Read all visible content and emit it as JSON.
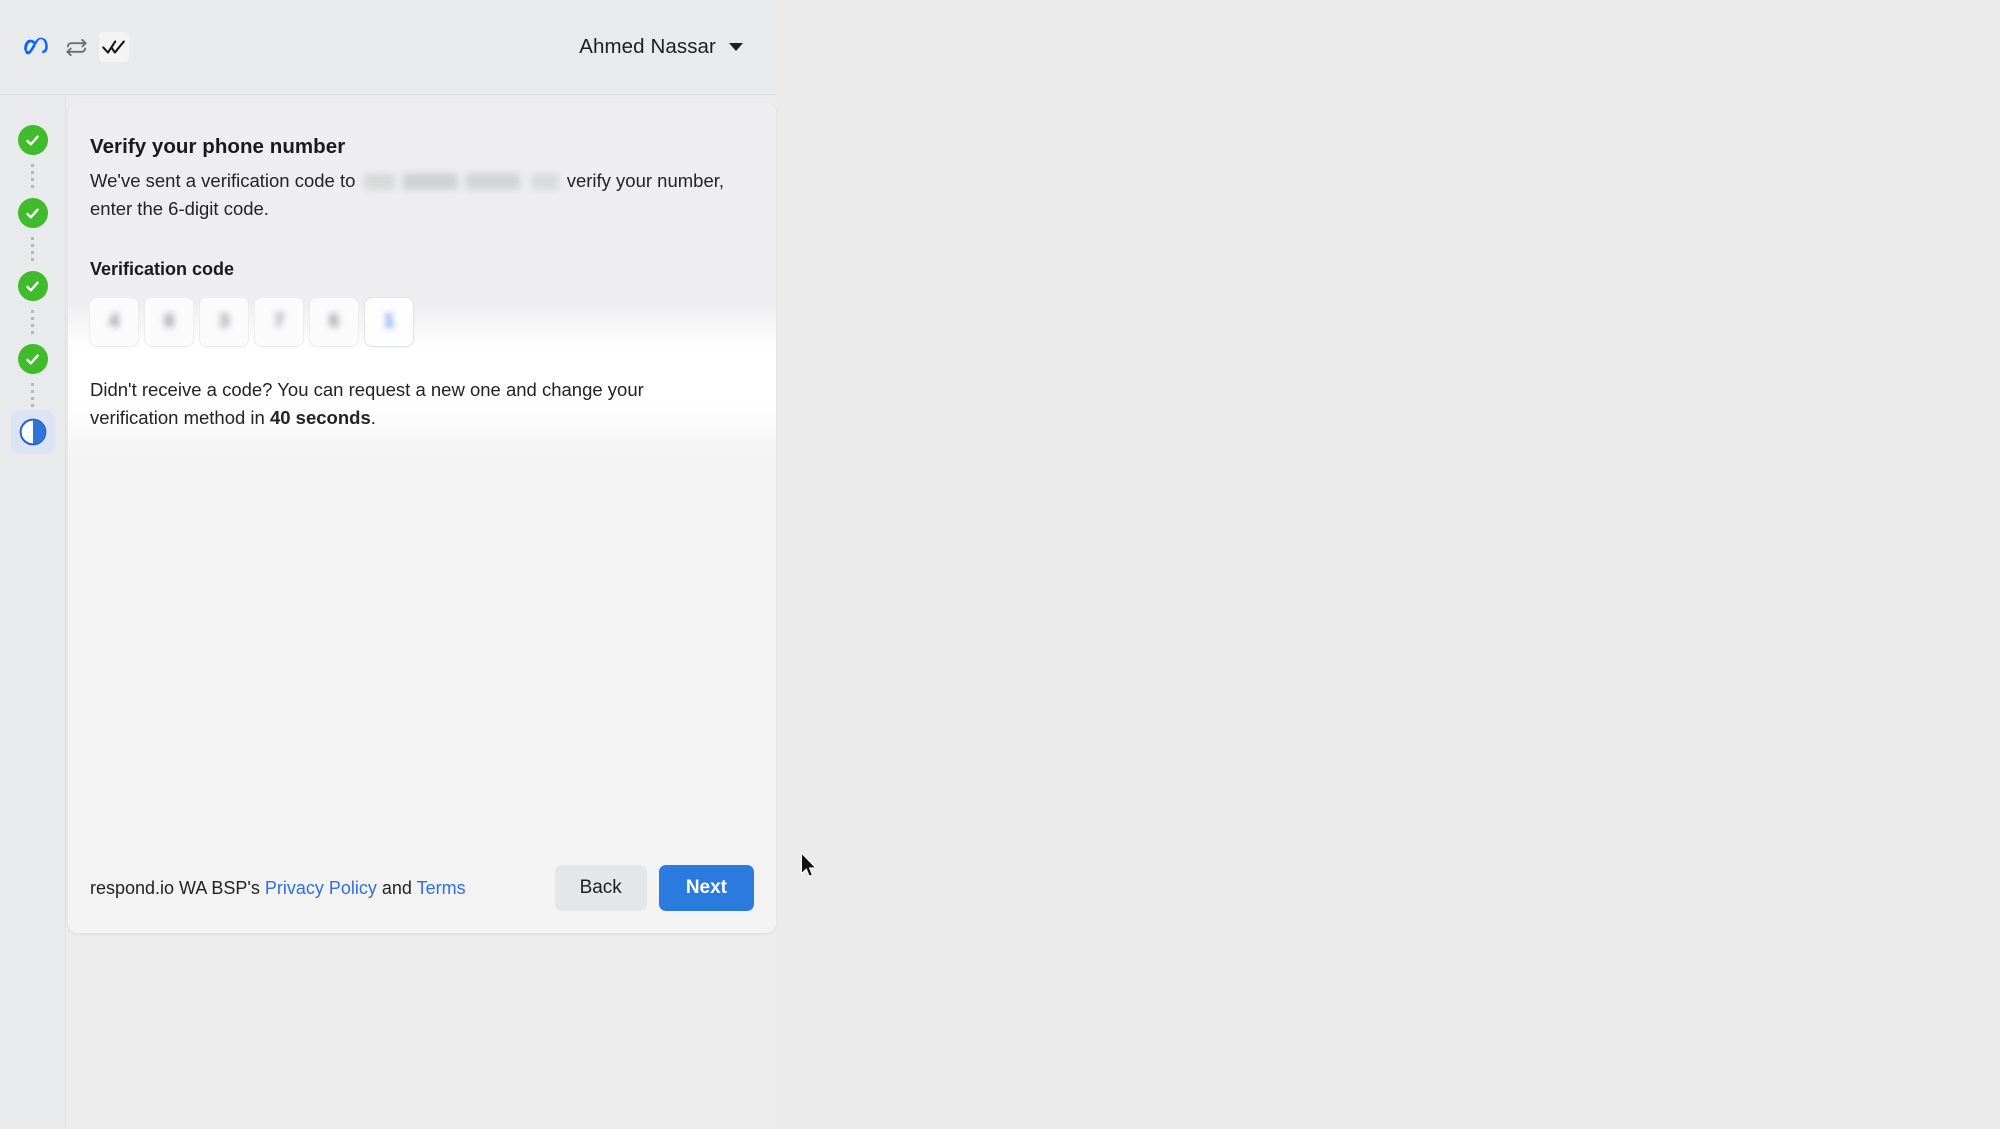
{
  "header": {
    "icons": [
      {
        "name": "meta-logo",
        "label": "Meta"
      },
      {
        "name": "sync-icon",
        "label": "Sync"
      },
      {
        "name": "whatsapp-double-check-icon",
        "label": "WhatsApp"
      }
    ],
    "user_name": "Ahmed Nassar",
    "caret": "▼"
  },
  "stepper": {
    "steps": [
      {
        "state": "completed",
        "name": "step-1"
      },
      {
        "state": "completed",
        "name": "step-2"
      },
      {
        "state": "completed",
        "name": "step-3"
      },
      {
        "state": "completed",
        "name": "step-4"
      },
      {
        "state": "current",
        "name": "step-5"
      }
    ]
  },
  "card": {
    "title": "Verify your phone number",
    "desc_before": "We've sent a verification code to",
    "desc_redacted": "",
    "desc_after": "verify your number, enter the 6-digit code.",
    "field_label": "Verification code",
    "otp": {
      "length": 6,
      "digits": [
        "4",
        "8",
        "3",
        "7",
        "6",
        "1"
      ],
      "focused_index": 5,
      "redacted": true
    },
    "resend_prefix": "Didn't receive a code? You can request a new one and change your verification method in ",
    "resend_timer": "40 seconds",
    "resend_suffix": "."
  },
  "footer": {
    "legal_prefix": "respond.io WA BSP's ",
    "privacy_policy": "Privacy Policy",
    "legal_middle": " and ",
    "terms": "Terms",
    "back_label": "Back",
    "next_label": "Next"
  },
  "colors": {
    "accent_blue": "#2b7bdf",
    "link_blue": "#2f6fe0",
    "success_green": "#40bb2b",
    "meta_blue": "#0866ff",
    "header_bg": "#e9eaec",
    "page_bg": "#ebebeb"
  }
}
